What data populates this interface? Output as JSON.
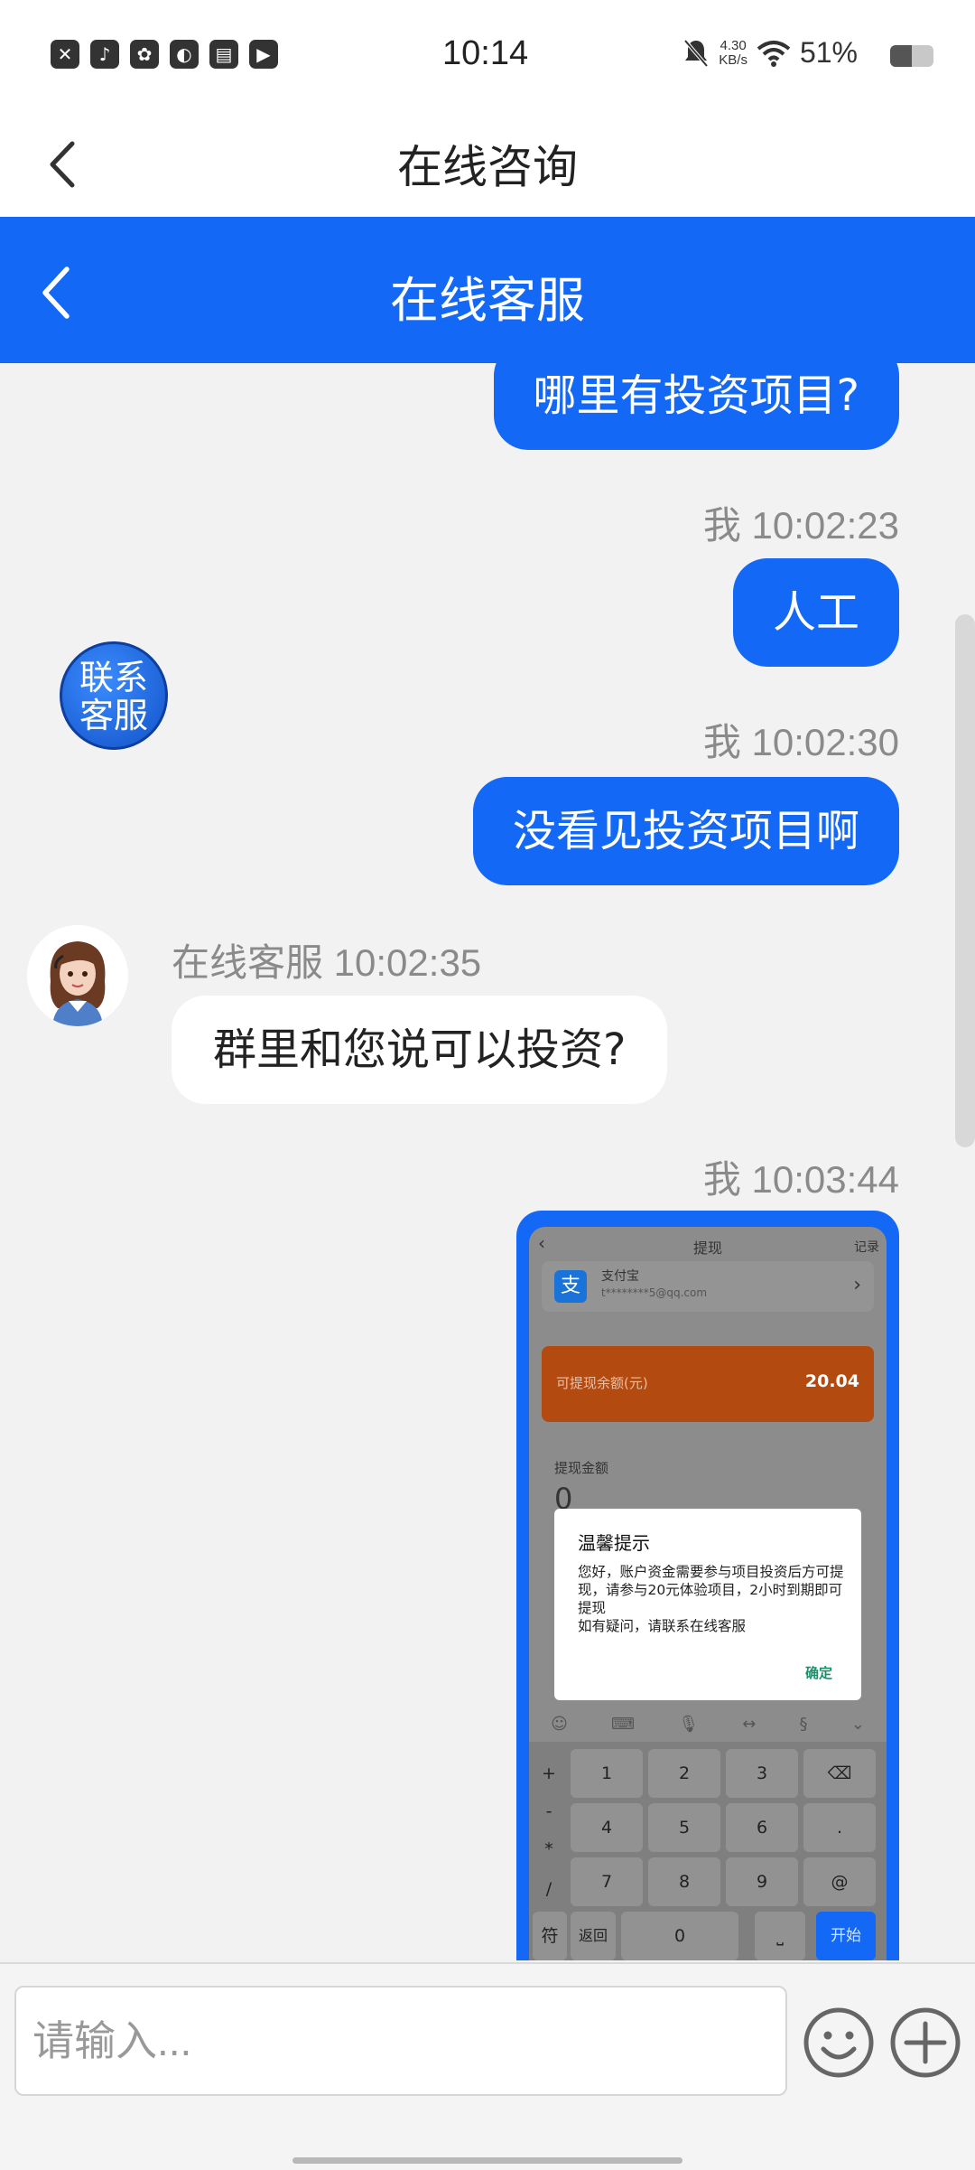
{
  "status_bar": {
    "time": "10:14",
    "app_icons": [
      "✕",
      "♪",
      "✿",
      "◐",
      "▤",
      "▶"
    ],
    "net_speed_value": "4.30",
    "net_speed_unit": "KB/s",
    "battery_pct": "51%"
  },
  "top_nav": {
    "title": "在线咨询"
  },
  "chat_header": {
    "title": "在线客服"
  },
  "contact_float": {
    "label_line1": "联系",
    "label_line2": "客服"
  },
  "messages": [
    {
      "from": "me",
      "text": "哪里有投资项目?"
    },
    {
      "from": "me",
      "stamp": "我 10:02:23",
      "text": "人工"
    },
    {
      "from": "me",
      "stamp": "我 10:02:30",
      "text": "没看见投资项目啊"
    },
    {
      "from": "cs",
      "stamp": "在线客服 10:02:35",
      "text": "群里和您说可以投资?"
    },
    {
      "from": "me",
      "stamp": "我 10:03:44",
      "image": "screenshot"
    }
  ],
  "shot": {
    "header_title": "提现",
    "header_right": "记录",
    "pay_name": "支付宝",
    "pay_account": "t********5@qq.com",
    "balance_label": "可提现余额(元)",
    "balance_value": "20.04",
    "amount_label": "提现金额",
    "amount_value": "0",
    "dialog_title": "温馨提示",
    "dialog_body": "您好，账户资金需要参与项目投资后方可提现，请参与20元体验项目，2小时到期即可提现\n如有疑问，请联系在线客服",
    "dialog_ok": "确定",
    "keys": {
      "side": [
        "+",
        "-",
        "*",
        "/"
      ],
      "row1": [
        "1",
        "2",
        "3",
        "⌫"
      ],
      "row2": [
        "4",
        "5",
        "6",
        "."
      ],
      "row3": [
        "7",
        "8",
        "9",
        "@"
      ],
      "fu": "符",
      "back": "返回",
      "zero": "0",
      "space": "⎵",
      "start": "开始"
    }
  },
  "input_bar": {
    "placeholder": "请输入..."
  }
}
